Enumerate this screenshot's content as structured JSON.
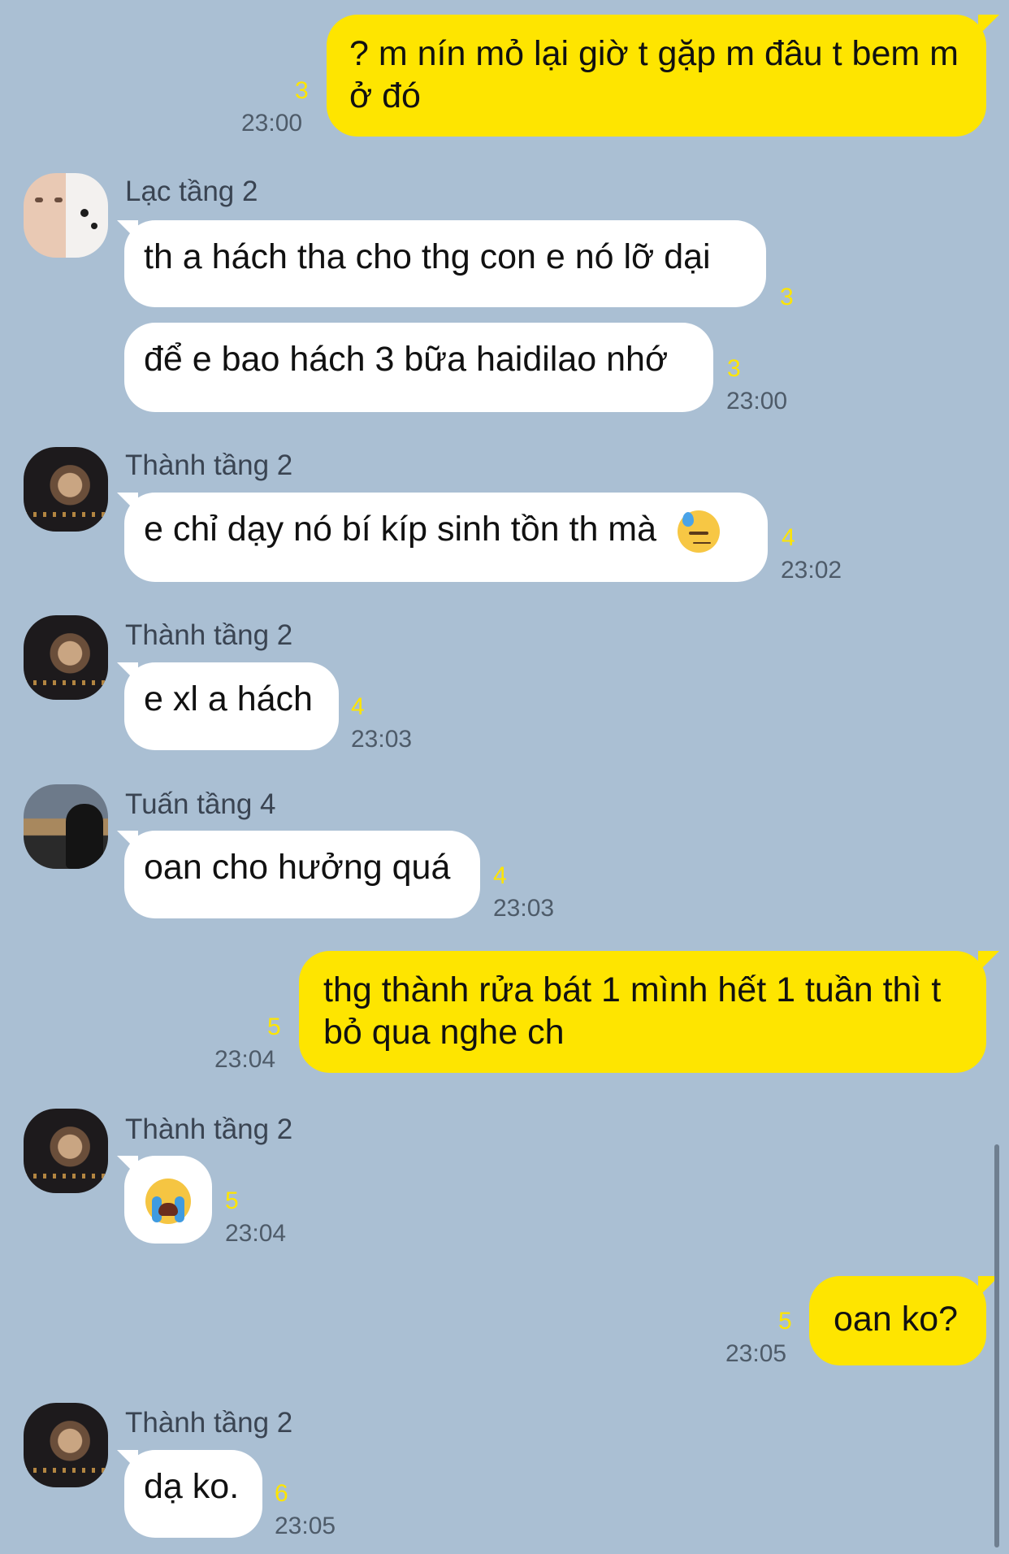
{
  "chat": {
    "messages": [
      {
        "id": "m1",
        "sender": "me",
        "text": "? m nín mỏ lại giờ t gặp m đâu t bem m ở đó",
        "unread": "3",
        "time": "23:00"
      },
      {
        "id": "m2",
        "sender_name": "Lạc tầng 2",
        "text": "th a hách tha cho thg con e nó lỡ dại",
        "unread": "3",
        "time": ""
      },
      {
        "id": "m3",
        "sender_name": "Lạc tầng 2",
        "text": "để e bao hách 3 bữa haidilao nhớ",
        "unread": "3",
        "time": "23:00"
      },
      {
        "id": "m4",
        "sender_name": "Thành tầng 2",
        "text": "e chỉ dạy nó bí kíp sinh tồn th mà",
        "emoji": "downcast-face-with-sweat",
        "unread": "4",
        "time": "23:02"
      },
      {
        "id": "m5",
        "sender_name": "Thành tầng 2",
        "text": "e xl a hách",
        "unread": "4",
        "time": "23:03"
      },
      {
        "id": "m6",
        "sender_name": "Tuấn tầng 4",
        "text": "oan cho hưởng quá",
        "unread": "4",
        "time": "23:03"
      },
      {
        "id": "m7",
        "sender": "me",
        "text": "thg thành rửa bát 1 mình hết 1 tuần thì t bỏ qua nghe ch",
        "unread": "5",
        "time": "23:04"
      },
      {
        "id": "m8",
        "sender_name": "Thành tầng 2",
        "text": "",
        "emoji": "loudly-crying-face",
        "unread": "5",
        "time": "23:04"
      },
      {
        "id": "m9",
        "sender": "me",
        "text": "oan ko?",
        "unread": "5",
        "time": "23:05"
      },
      {
        "id": "m10",
        "sender_name": "Thành tầng 2",
        "text": "dạ ko.",
        "unread": "6",
        "time": "23:05"
      }
    ]
  },
  "colors": {
    "background": "#aabfd3",
    "my_bubble": "#fee500",
    "other_bubble": "#ffffff",
    "unread_count": "#fee500"
  }
}
